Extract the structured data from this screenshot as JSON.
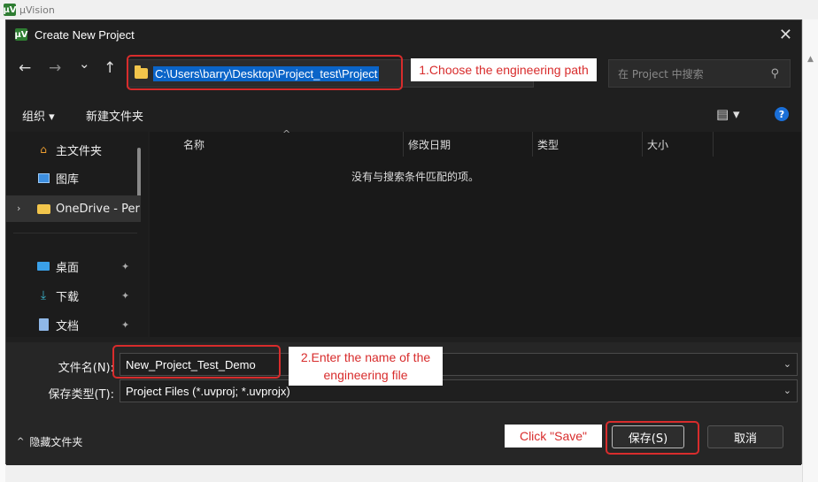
{
  "app": {
    "title": "µVision",
    "logo": "µV"
  },
  "dialog": {
    "title": "Create New Project",
    "close_glyph": "✕",
    "nav": {
      "back": "←",
      "forward": "→",
      "recent": "⌄",
      "up": "↑"
    },
    "address_path": "C:\\Users\\barry\\Desktop\\Project_test\\Project",
    "address_chevron": "⌄",
    "refresh_glyph": "↻",
    "search_placeholder": "在 Project 中搜索",
    "search_glyph": "⚲",
    "toolbar": {
      "organize": "组织 ▾",
      "new_folder": "新建文件夹",
      "view_glyph": "▤ ▾",
      "help_glyph": "?"
    },
    "sidebar": {
      "expand_glyph": "›",
      "items": [
        {
          "label": "主文件夹",
          "icon": "home-icon"
        },
        {
          "label": "图库",
          "icon": "gallery-icon"
        },
        {
          "label": "OneDrive - Per",
          "icon": "folder-icon"
        },
        {
          "label": "桌面",
          "icon": "desktop-icon"
        },
        {
          "label": "下载",
          "icon": "download-icon"
        },
        {
          "label": "文档",
          "icon": "document-icon"
        }
      ],
      "pin_glyph": "📌"
    },
    "columns": {
      "name": "名称",
      "modified": "修改日期",
      "type": "类型",
      "size": "大小",
      "sort_glyph": "^"
    },
    "empty_message": "没有与搜索条件匹配的项。",
    "filename_label": "文件名(N):",
    "filename_value": "New_Project_Test_Demo",
    "filetype_label": "保存类型(T):",
    "filetype_value": "Project Files (*.uvproj; *.uvprojx)",
    "dropdown_glyph": "⌄",
    "hide_folders": "隐藏文件夹",
    "hide_folders_glyph": "^",
    "save_button": "保存(S)",
    "cancel_button": "取消"
  },
  "annotations": {
    "step1": "1.Choose the engineering path",
    "step2_line1": "2.Enter the name of the",
    "step2_line2": "engineering file",
    "step3": "Click \"Save\""
  },
  "colors": {
    "annotation": "#d82c2c",
    "selection": "#0a64c8",
    "dialog_bg": "#1f1f1f"
  }
}
